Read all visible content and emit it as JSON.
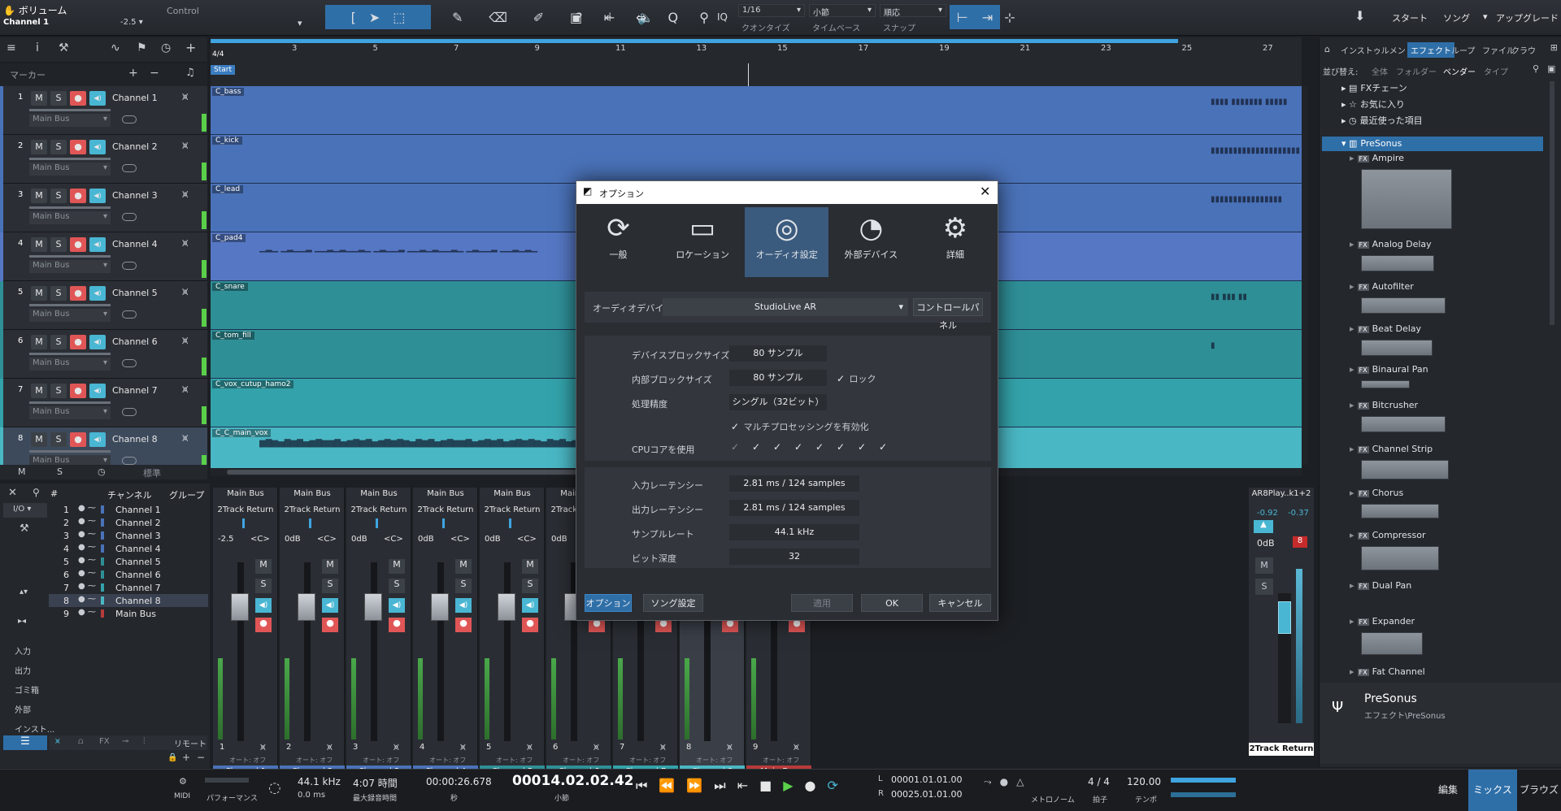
{
  "toolbar": {
    "volume_label": "ボリューム",
    "channel_label": "Channel 1",
    "control_label": "Control",
    "volume_value": "-2.5",
    "iq_label": "IQ",
    "quantize_value": "1/16",
    "quantize_label": "クオンタイズ",
    "timebase_value": "小節",
    "timebase_label": "タイムベース",
    "snap_value": "順応",
    "snap_label": "スナップ",
    "start_label": "スタート",
    "song_label": "ソング",
    "upgrade_label": "アップグレード"
  },
  "ruler": {
    "marks": [
      "3",
      "5",
      "7",
      "9",
      "11",
      "13",
      "15",
      "17",
      "19",
      "21",
      "23",
      "25",
      "27"
    ],
    "time_sig": "4/4",
    "marker_label": "マーカー",
    "start_marker": "Start"
  },
  "tracks": [
    {
      "num": "1",
      "name": "Channel 1",
      "bus": "Main Bus",
      "lane": "C_bass",
      "color": "#4a72b8"
    },
    {
      "num": "2",
      "name": "Channel 2",
      "bus": "Main Bus",
      "lane": "C_kick",
      "color": "#4a72b8"
    },
    {
      "num": "3",
      "name": "Channel 3",
      "bus": "Main Bus",
      "lane": "C_lead",
      "color": "#4a72b8"
    },
    {
      "num": "4",
      "name": "Channel 4",
      "bus": "Main Bus",
      "lane": "C_pad4",
      "color": "#5577c4"
    },
    {
      "num": "5",
      "name": "Channel 5",
      "bus": "Main Bus",
      "lane": "C_snare",
      "color": "#2f8f97"
    },
    {
      "num": "6",
      "name": "Channel 6",
      "bus": "Main Bus",
      "lane": "C_tom_fill",
      "color": "#2f8f97"
    },
    {
      "num": "7",
      "name": "Channel 7",
      "bus": "Main Bus",
      "lane": "C_vox_cutup_hamo2",
      "color": "#33a2aa"
    },
    {
      "num": "8",
      "name": "Channel 8",
      "bus": "Main Bus",
      "lane": "C_C_main_vox",
      "color": "#4ab7c4"
    }
  ],
  "track_footer": {
    "m": "M",
    "s": "S",
    "standard": "標準"
  },
  "mixer_list": {
    "header_hash": "#",
    "header_channel": "チャンネル",
    "header_group": "グループ",
    "io_label": "I/O",
    "items": [
      {
        "num": "1",
        "name": "Channel 1"
      },
      {
        "num": "2",
        "name": "Channel 2"
      },
      {
        "num": "3",
        "name": "Channel 3"
      },
      {
        "num": "4",
        "name": "Channel 4"
      },
      {
        "num": "5",
        "name": "Channel 5"
      },
      {
        "num": "6",
        "name": "Channel 6"
      },
      {
        "num": "7",
        "name": "Channel 7"
      },
      {
        "num": "8",
        "name": "Channel 8"
      },
      {
        "num": "9",
        "name": "Main Bus"
      }
    ],
    "side_labels": [
      "入力",
      "出力",
      "ゴミ箱",
      "外部",
      "インスト..."
    ]
  },
  "strips": [
    {
      "num": "1",
      "name": "Channel 1",
      "vol": "-2.5",
      "pan": "<C>",
      "color": "#4a72b8"
    },
    {
      "num": "2",
      "name": "Channel 2",
      "vol": "0dB",
      "pan": "<C>",
      "color": "#4a72b8"
    },
    {
      "num": "3",
      "name": "Channel 3",
      "vol": "0dB",
      "pan": "<C>",
      "color": "#4a72b8"
    },
    {
      "num": "4",
      "name": "Channel 4",
      "vol": "0dB",
      "pan": "<C>",
      "color": "#4a72b8"
    },
    {
      "num": "5",
      "name": "Channel 5",
      "vol": "0dB",
      "pan": "<C>",
      "color": "#2f8f97"
    },
    {
      "num": "6",
      "name": "Channel 6",
      "vol": "0dB",
      "pan": "<C>",
      "color": "#2f8f97"
    },
    {
      "num": "7",
      "name": "Channel 7",
      "vol": "",
      "pan": "",
      "color": "#33a2aa"
    },
    {
      "num": "8",
      "name": "Channel 8",
      "vol": "",
      "pan": "",
      "color": "#4ab7c4"
    },
    {
      "num": "9",
      "name": "Main Bus",
      "vol": "",
      "pan": "",
      "color": "#b83a3a"
    }
  ],
  "strip_common": {
    "bus": "Main Bus",
    "return": "2Track Return",
    "m": "M",
    "s": "S",
    "auto": "オート: オフ"
  },
  "mixer_footer": {
    "remote": "リモート"
  },
  "right_strip": {
    "title": "AR8Play..k1+2",
    "l": "-0.92",
    "r": "-0.37",
    "vol": "0dB",
    "clip": "8",
    "name": "2Track Return"
  },
  "dialog": {
    "title": "オプション",
    "tabs": [
      "一般",
      "ロケーション",
      "オーディオ設定",
      "外部デバイス",
      "詳細"
    ],
    "device_label": "オーディオデバイス",
    "device_value": "StudioLive AR",
    "control_panel": "コントロールパネル",
    "block_label": "デバイスブロックサイズ",
    "block_value": "80 サンプル",
    "internal_label": "内部ブロックサイズ",
    "internal_value": "80 サンプル",
    "lock_label": "ロック",
    "precision_label": "処理精度",
    "precision_value": "シングル（32ビット）",
    "multi_label": "マルチプロセッシングを有効化",
    "cpu_label": "CPUコアを使用",
    "in_latency_label": "入力レーテンシー",
    "in_latency_value": "2.81 ms / 124 samples",
    "out_latency_label": "出力レーテンシー",
    "out_latency_value": "2.81 ms / 124 samples",
    "rate_label": "サンプルレート",
    "rate_value": "44.1 kHz",
    "depth_label": "ビット深度",
    "depth_value": "32",
    "btn_options": "オプション",
    "btn_song": "ソング設定",
    "btn_apply": "適用",
    "btn_ok": "OK",
    "btn_cancel": "キャンセル"
  },
  "browser": {
    "tabs": [
      "インストゥルメント",
      "エフェクト",
      "ループ",
      "ファイル",
      "クラウ"
    ],
    "sort_label": "並び替え:",
    "sort_options": [
      "全体",
      "フォルダー",
      "ベンダー",
      "タイプ"
    ],
    "items": [
      "FXチェーン",
      "お気に入り",
      "最近使った項目"
    ],
    "vendor": "PreSonus",
    "effects": [
      "Ampire",
      "Analog Delay",
      "Autofilter",
      "Beat Delay",
      "Binaural Pan",
      "Bitcrusher",
      "Channel Strip",
      "Chorus",
      "Compressor",
      "Dual Pan",
      "Expander",
      "Fat Channel"
    ],
    "footer_title": "PreSonus",
    "footer_path": "エフェクト\\PreSonus"
  },
  "transport": {
    "midi": "MIDI",
    "perf": "パフォーマンス",
    "rate": "44.1 kHz",
    "latency": "0.0 ms",
    "rec_time": "4:07 時間",
    "rec_time_label": "最大録音時間",
    "seconds": "00:00:26.678",
    "seconds_label": "秒",
    "bars": "00014.02.02.42",
    "bars_label": "小節",
    "loop_l": "00001.01.01.00",
    "loop_r": "00025.01.01.00",
    "metronome": "メトロノーム",
    "sig": "4 / 4",
    "sig_label": "拍子",
    "tempo": "120.00",
    "tempo_label": "テンポ",
    "edit": "編集",
    "mix": "ミックス",
    "browse": "ブラウズ"
  }
}
